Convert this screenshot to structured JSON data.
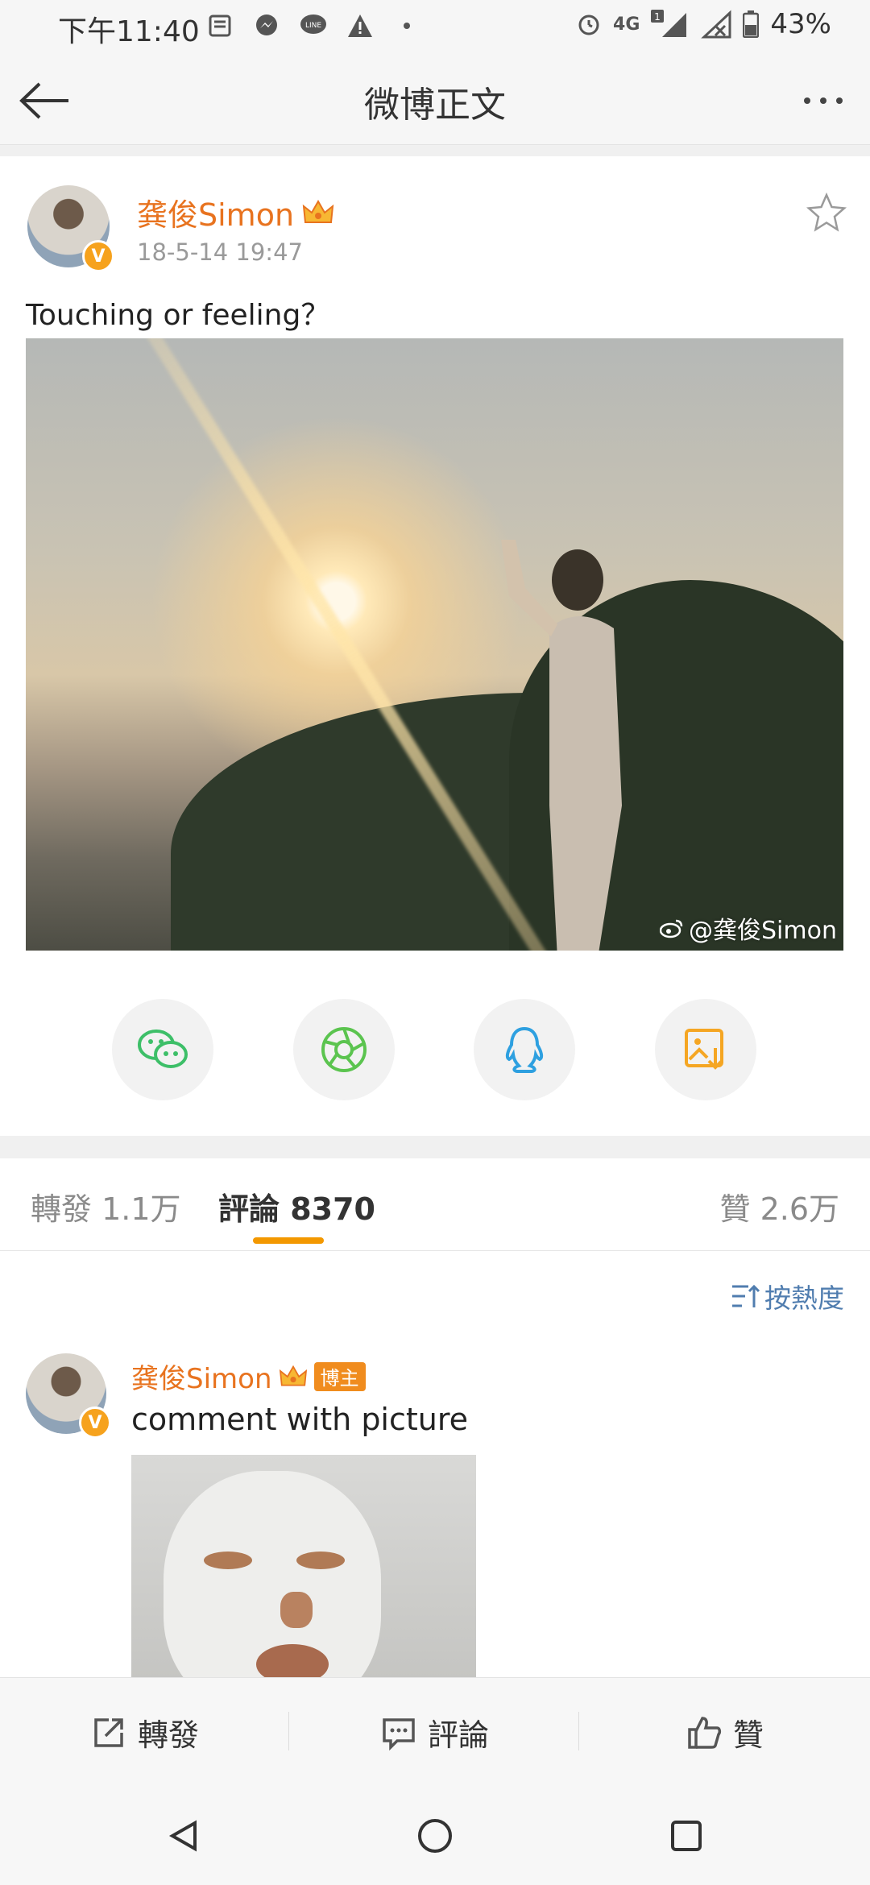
{
  "status_bar": {
    "time": "下午11:40",
    "network": "4G",
    "sim_badge": "1",
    "battery": "43%"
  },
  "header": {
    "title": "微博正文"
  },
  "post": {
    "author": "龚俊Simon",
    "time": "18-5-14 19:47",
    "text": "Touching or feeling？",
    "watermark": "@龚俊Simon"
  },
  "share_buttons": [
    {
      "name": "wechat-icon",
      "color": "#3dbf68"
    },
    {
      "name": "moments-icon",
      "color": "#5bc44f"
    },
    {
      "name": "qq-icon",
      "color": "#2ea0e0"
    },
    {
      "name": "save-image-icon",
      "color": "#f5a623"
    }
  ],
  "tabs": {
    "repost": "轉發 1.1万",
    "comments": "評論 8370",
    "likes": "贊 2.6万"
  },
  "sort": {
    "label": "按熱度"
  },
  "comment": {
    "author": "龚俊Simon",
    "badge": "博主",
    "text": "comment with picture"
  },
  "action_bar": {
    "repost": "轉發",
    "comment": "評論",
    "like": "贊"
  },
  "colors": {
    "accent_orange": "#e8731f",
    "tab_indicator": "#f39800",
    "link_blue": "#507daf"
  }
}
